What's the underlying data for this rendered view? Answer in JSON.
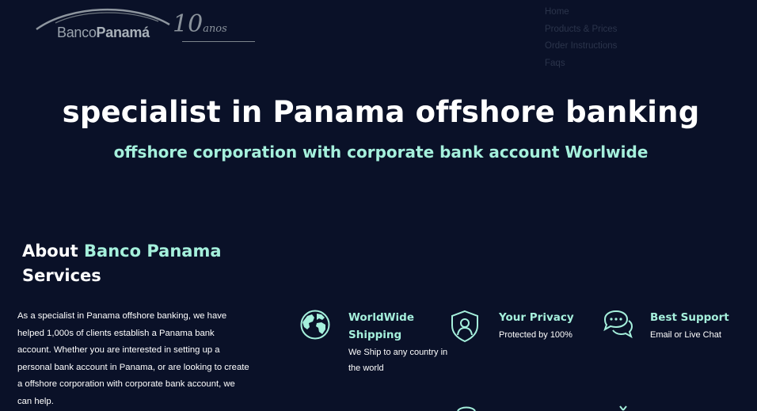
{
  "logo": {
    "brand_regular": "Banco",
    "brand_bold": "Panamá",
    "years": "10",
    "years_suffix": "anos"
  },
  "nav": {
    "items": [
      "Home",
      "Products & Prices",
      "Order Instructions",
      "Faqs"
    ]
  },
  "hero": {
    "title": "specialist in Panama offshore banking",
    "subtitle": "offshore corporation with corporate bank account Worlwide"
  },
  "about": {
    "title_prefix": "About",
    "title_accent": "Banco Panama",
    "title_suffix": "Services",
    "text": "As a specialist in Panama offshore banking, we have helped 1,000s of clients establish a Panama bank account. Whether you are interested in setting up a personal bank account in Panama, or are looking to create a offshore corporation with corporate bank account, we can help."
  },
  "features": [
    {
      "icon": "globe-icon",
      "title": "WorldWide Shipping",
      "description": "We Ship to any country in the world"
    },
    {
      "icon": "shield-user-icon",
      "title": "Your Privacy",
      "description": "Protected by 100%"
    },
    {
      "icon": "chat-bubbles-icon",
      "title": "Best Support",
      "description": "Email or Live Chat"
    }
  ],
  "colors": {
    "background": "#0a1128",
    "accent": "#a5f0dc",
    "text": "#ffffff",
    "nav_text": "#2b344b"
  }
}
